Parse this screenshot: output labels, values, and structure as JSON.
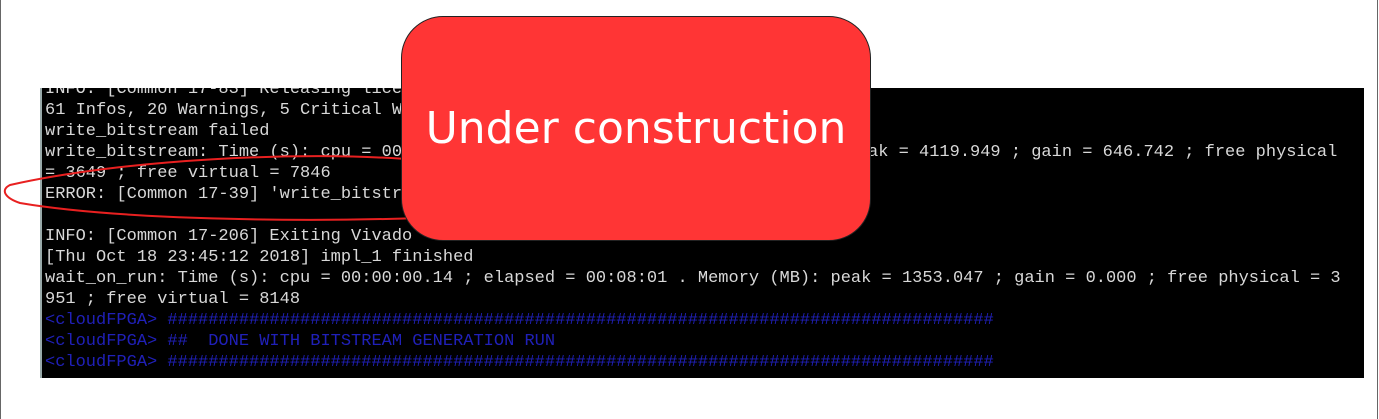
{
  "terminal": {
    "lines": [
      "INFO: [Common 17-83] Releasing lice",
      "61 Infos, 20 Warnings, 5 Critical W",
      "write_bitstream failed",
      "write_bitstream: Time (s): cpu = 00",
      "= 3649 ; free virtual = 7846",
      "ERROR: [Common 17-39] 'write_bitstr",
      "",
      "INFO: [Common 17-206] Exiting Vivado",
      "[Thu Oct 18 23:45:12 2018] impl_1 finished",
      "wait_on_run: Time (s): cpu = 00:00:00.14 ; elapsed = 00:08:01 . Memory (MB): peak = 1353.047 ; gain = 0.000 ; free physical = 3",
      "951 ; free virtual = 8148",
      "<cloudFPGA> #################################################################################",
      "<cloudFPGA> ##  DONE WITH BITSTREAM GENERATION RUN",
      "<cloudFPGA> #################################################################################"
    ],
    "line4_right": "ak = 4119.949 ; gain = 646.742 ; free physical"
  },
  "overlay": {
    "label": "Under construction",
    "color": "#ff3535"
  },
  "highlight_color": "#e82020"
}
